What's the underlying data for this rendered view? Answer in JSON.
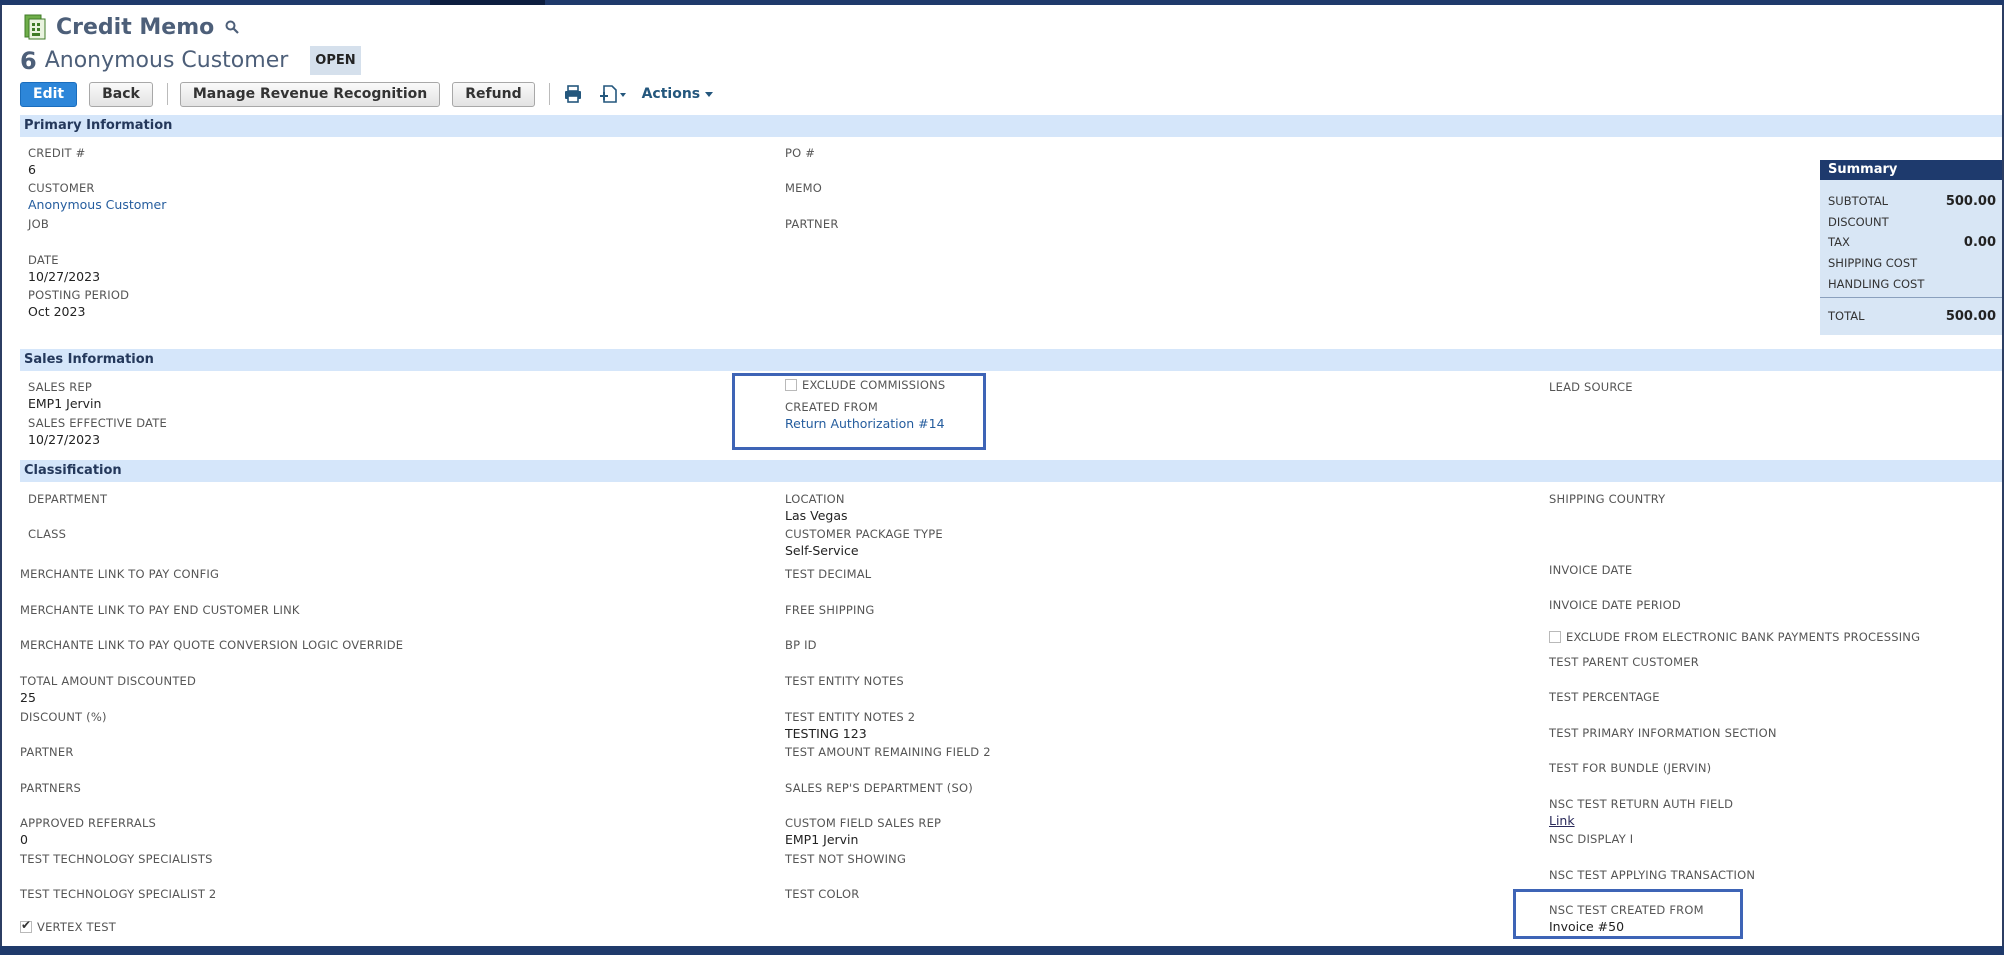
{
  "header": {
    "title": "Credit Memo",
    "record_number": "6",
    "record_name": "Anonymous Customer",
    "status": "OPEN"
  },
  "toolbar": {
    "edit": "Edit",
    "back": "Back",
    "manage_rev": "Manage Revenue Recognition",
    "refund": "Refund",
    "actions": "Actions"
  },
  "sections": {
    "primary": "Primary Information",
    "sales": "Sales Information",
    "classification": "Classification"
  },
  "primary": {
    "credit_label": "CREDIT #",
    "credit_value": "6",
    "customer_label": "CUSTOMER",
    "customer_value": "Anonymous Customer",
    "job_label": "JOB",
    "date_label": "DATE",
    "date_value": "10/27/2023",
    "posting_label": "POSTING PERIOD",
    "posting_value": "Oct 2023",
    "po_label": "PO #",
    "memo_label": "MEMO",
    "partner_label": "PARTNER"
  },
  "summary": {
    "title": "Summary",
    "subtotal_label": "SUBTOTAL",
    "subtotal": "500.00",
    "discount_label": "DISCOUNT",
    "tax_label": "TAX",
    "tax": "0.00",
    "shipping_label": "SHIPPING COST",
    "handling_label": "HANDLING COST",
    "total_label": "TOTAL",
    "total": "500.00"
  },
  "sales": {
    "rep_label": "SALES REP",
    "rep_value": "EMP1 Jervin",
    "eff_label": "SALES EFFECTIVE DATE",
    "eff_value": "10/27/2023",
    "exclude_comm_label": "EXCLUDE COMMISSIONS",
    "created_from_label": "CREATED FROM",
    "created_from_value": "Return Authorization #14",
    "lead_label": "LEAD SOURCE"
  },
  "classification": {
    "col1": {
      "department": "DEPARTMENT",
      "class": "CLASS",
      "merch_config": "MERCHANTE LINK TO PAY CONFIG",
      "merch_end": "MERCHANTE LINK TO PAY END CUSTOMER LINK",
      "merch_quote": "MERCHANTE LINK TO PAY QUOTE CONVERSION LOGIC OVERRIDE",
      "total_disc_label": "TOTAL AMOUNT DISCOUNTED",
      "total_disc_value": "25",
      "discount_pct": "DISCOUNT (%)",
      "partner": "PARTNER",
      "partners": "PARTNERS",
      "approved_label": "APPROVED REFERRALS",
      "approved_value": "0",
      "tech1": "TEST TECHNOLOGY SPECIALISTS",
      "tech2": "TEST TECHNOLOGY SPECIALIST 2",
      "vertex": "VERTEX TEST"
    },
    "col2": {
      "location_label": "LOCATION",
      "location_value": "Las Vegas",
      "pkg_label": "CUSTOMER PACKAGE TYPE",
      "pkg_value": "Self-Service",
      "test_decimal": "TEST DECIMAL",
      "free_shipping": "FREE SHIPPING",
      "bp_id": "BP ID",
      "entity_notes": "TEST ENTITY NOTES",
      "entity_notes2_label": "TEST ENTITY NOTES 2",
      "entity_notes2_value": "TESTING 123",
      "amount_remaining": "TEST AMOUNT REMAINING FIELD 2",
      "rep_dept": "SALES REP'S DEPARTMENT (SO)",
      "custom_rep_label": "CUSTOM FIELD SALES REP",
      "custom_rep_value": "EMP1 Jervin",
      "not_showing": "TEST NOT SHOWING",
      "color": "TEST COLOR"
    },
    "col3": {
      "ship_country": "SHIPPING COUNTRY",
      "invoice_date": "INVOICE DATE",
      "invoice_period": "INVOICE DATE PERIOD",
      "exclude_ebp": "EXCLUDE FROM ELECTRONIC BANK PAYMENTS PROCESSING",
      "parent_customer": "TEST PARENT CUSTOMER",
      "percentage": "TEST PERCENTAGE",
      "primary_section": "TEST PRIMARY INFORMATION SECTION",
      "bundle": "TEST FOR BUNDLE (JERVIN)",
      "return_auth_label": "NSC TEST RETURN AUTH FIELD",
      "return_auth_value": "Link",
      "display": "NSC DISPLAY I",
      "applying": "NSC TEST APPLYING TRANSACTION",
      "created_from_label": "NSC TEST CREATED FROM",
      "created_from_value": "Invoice #50"
    }
  }
}
